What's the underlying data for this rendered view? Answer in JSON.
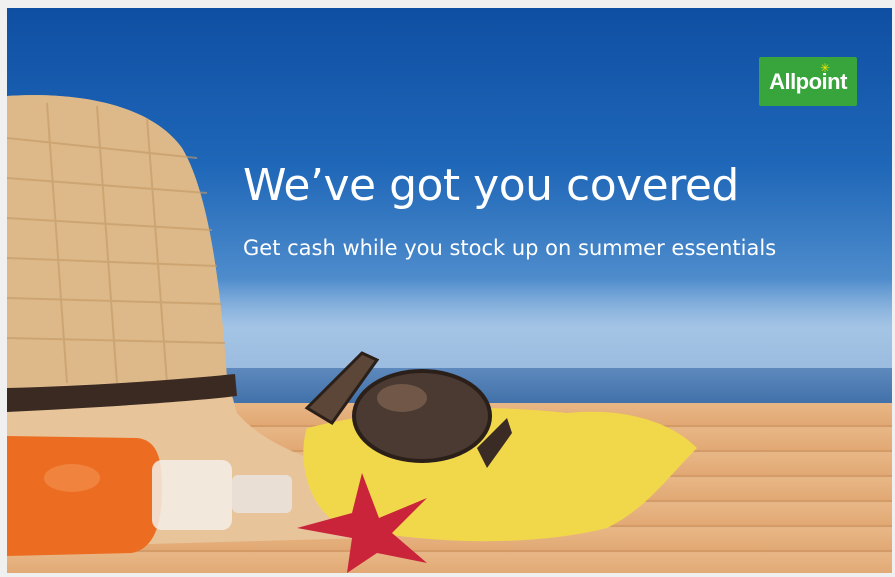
{
  "banner": {
    "brand": "Allpoint",
    "headline": "We’ve got you covered",
    "subheadline": "Get cash while you stock up on summer essentials"
  },
  "colors": {
    "sky_top": "#0f4fa3",
    "brand_green": "#37a53b",
    "text": "#ffffff"
  },
  "icons": [
    "allpoint-logo",
    "straw-hat-image",
    "sunglasses-image",
    "sunscreen-bottle-image",
    "starfish-image",
    "towel-image"
  ]
}
